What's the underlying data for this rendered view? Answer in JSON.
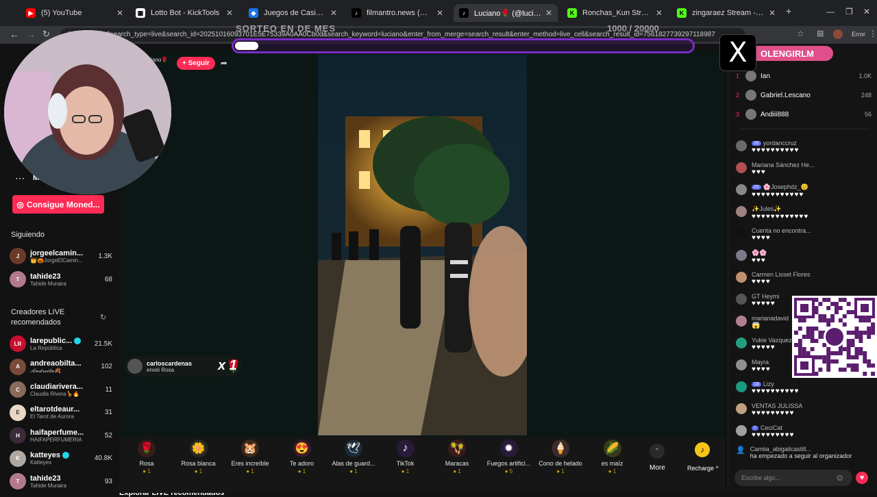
{
  "browser": {
    "tabs": [
      {
        "title": "(5) YouTube",
        "icon": "youtube-icon",
        "color": "#ff0000",
        "glyph": "▶",
        "active": false
      },
      {
        "title": "Lotto Bot - KickTools",
        "icon": "kicktools-icon",
        "color": "#ffffff",
        "glyph": "▦",
        "active": false
      },
      {
        "title": "Juegos de Casino Online | Apu",
        "icon": "casino-icon",
        "color": "#1a73e8",
        "glyph": "◆",
        "active": false
      },
      {
        "title": "filmantro.news (@filmantro.ne",
        "icon": "tiktok-icon",
        "color": "#000000",
        "glyph": "♪",
        "active": false
      },
      {
        "title": "Luciano🌹 (@lucianorj)",
        "icon": "tiktok-icon",
        "color": "#000000",
        "glyph": "♪",
        "active": true
      },
      {
        "title": "Ronchas_Kun Stream - Watch L",
        "icon": "kick-icon",
        "color": "#53fc18",
        "glyph": "K",
        "active": false
      },
      {
        "title": "zingaraez Stream - Watch Live",
        "icon": "kick-icon",
        "color": "#53fc18",
        "glyph": "K",
        "active": false
      }
    ],
    "new_tab": "+",
    "url": "lucianorj/live?search_type=live&search_id=20251016093701E5E75339A0AA0Cb0d&search_keyword=luciano&enter_from_merge=search_result&enter_method=live_cell&search_result_id=7561827739297118987",
    "error_label": "Error"
  },
  "overlay": {
    "progress_label": "SORTEO EN DE MES",
    "progress_count": "1000 / 20000",
    "progress_fraction": 0.05,
    "x_logo": "X",
    "handle": "OLENGIRLM"
  },
  "leftnav": {
    "more_label": "Más",
    "coins_button": "Consigue Moned...",
    "following_title": "Siguiendo",
    "following": [
      {
        "name": "jorgeelcamin...",
        "sub": "👑🎃JorgeElCamin...",
        "count": "1.3K",
        "color": "#6b3b2a",
        "initial": "J"
      },
      {
        "name": "tahide23",
        "sub": "Tahide Muraira",
        "count": "68",
        "color": "#b37a8c",
        "initial": "T"
      }
    ],
    "recommended_title_1": "Creadores LIVE",
    "recommended_title_2": "recomendados",
    "recommended": [
      {
        "name": "larepublic...",
        "sub": "La República",
        "count": "21.5K",
        "color": "#c8102e",
        "initial": "LR",
        "verified": true
      },
      {
        "name": "andreaobilta...",
        "sub": "𝓐𝓷𝓭𝓻𝓮𝓲𝓽𝓪🍂",
        "count": "102",
        "color": "#7a4a3a",
        "initial": "A",
        "verified": false
      },
      {
        "name": "claudiarivera...",
        "sub": "Claudia Rivera🦒🔥",
        "count": "11",
        "color": "#8a6a5a",
        "initial": "C",
        "verified": false
      },
      {
        "name": "eltarotdeaur...",
        "sub": "El Tarot de Aurora",
        "count": "31",
        "color": "#e8d7c5",
        "initial": "E",
        "verified": false
      },
      {
        "name": "haifaperfume...",
        "sub": "HAIFAPERFUMERIA",
        "count": "52",
        "color": "#3a2a3a",
        "initial": "H",
        "verified": false
      },
      {
        "name": "katteyes",
        "sub": "Katteyes",
        "count": "40.8K",
        "color": "#b0a8a0",
        "initial": "K",
        "verified": true
      },
      {
        "name": "tahide23",
        "sub": "Tahide Muraira",
        "count": "93",
        "color": "#b37a8c",
        "initial": "T",
        "verified": false
      }
    ],
    "bottom_text": "Explorar LIVE recomendados"
  },
  "player": {
    "host_name": "luciano🌹",
    "host_sub": "K",
    "follow_label": "+ Seguir",
    "gift_user": "carloscardenas",
    "gift_action": "envió Rosa",
    "gift_multiplier": "x 1"
  },
  "gifts": [
    {
      "name": "Rosa",
      "price": "1",
      "emoji": "🌹",
      "bg": "#3a1a1a"
    },
    {
      "name": "Rosa blanca",
      "price": "1",
      "emoji": "🌼",
      "bg": "#2a2a20"
    },
    {
      "name": "Eres increíble",
      "price": "1",
      "emoji": "🐹",
      "bg": "#3a2a1a"
    },
    {
      "name": "Te adoro",
      "price": "1",
      "emoji": "😍",
      "bg": "#3a1a2a"
    },
    {
      "name": "Alas de guard...",
      "price": "1",
      "emoji": "🕊",
      "bg": "#1a2a3a"
    },
    {
      "name": "TikTok",
      "price": "1",
      "emoji": "♪",
      "bg": "#2a1a3a"
    },
    {
      "name": "Maracas",
      "price": "1",
      "emoji": "🪇",
      "bg": "#3a1a1a"
    },
    {
      "name": "Fuegos artifici...",
      "price": "5",
      "emoji": "✹",
      "bg": "#2a1a3a"
    },
    {
      "name": "Cono de helado",
      "price": "1",
      "emoji": "🍦",
      "bg": "#3a2a2a"
    },
    {
      "name": "es maíz",
      "price": "1",
      "emoji": "🌽",
      "bg": "#3a3a1a"
    }
  ],
  "gift_more": "More",
  "recharge_label": "Recharge ^",
  "chat": {
    "ranking": [
      {
        "rank": "1",
        "name": "Ian",
        "score": "1.0K"
      },
      {
        "rank": "2",
        "name": "Gabriel.Lescano",
        "score": "248"
      },
      {
        "rank": "3",
        "name": "Andiii888",
        "score": "56"
      }
    ],
    "messages": [
      {
        "user": "yordanccruz",
        "badge": "20",
        "text": "♥♥♥♥♥♥♥♥♥♥",
        "color": "#6a6a6a"
      },
      {
        "user": "Mariana Sánchez He...",
        "badge": "",
        "text": "♥♥♥",
        "color": "#b05050"
      },
      {
        "user": "🌸Josephdz_😊",
        "badge": "25",
        "text": "♥♥♥♥♥♥♥♥♥♥♥",
        "color": "#888888"
      },
      {
        "user": "✨Jules✨",
        "badge": "",
        "text": "♥♥♥♥♥♥♥♥♥♥♥♥",
        "color": "#a08080"
      },
      {
        "user": "Cuenta no encontra...",
        "badge": "",
        "text": "♥♥♥♥",
        "color": "#111111"
      },
      {
        "user": "🌸🌸",
        "badge": "",
        "text": "♥♥♥",
        "color": "#7a7a8a"
      },
      {
        "user": "Carmen Lisset Flores",
        "badge": "",
        "text": "♥♥♥♥",
        "color": "#c09070"
      },
      {
        "user": "GT Heymi",
        "badge": "",
        "text": "♥♥♥♥♥",
        "color": "#555555"
      },
      {
        "user": "marianadavid",
        "badge": "",
        "text": "😱",
        "color": "#b08090"
      },
      {
        "user": "Yukie Vazquez",
        "badge": "",
        "text": "♥♥♥♥♥",
        "color": "#20a080"
      },
      {
        "user": "Mayra",
        "badge": "",
        "text": "♥♥♥♥",
        "color": "#909090"
      },
      {
        "user": "Lizy",
        "badge": "18",
        "text": "♥♥♥♥♥♥♥♥♥♥",
        "color": "#1a9a80"
      },
      {
        "user": "VENTAS JULISSA",
        "badge": "",
        "text": "♥♥♥♥♥♥♥♥♥",
        "color": "#c0a080"
      },
      {
        "user": "CeciCat",
        "badge": "7",
        "text": "♥♥♥♥♥♥♥♥♥",
        "color": "#a0a0a0"
      }
    ],
    "join_user": "Camiia_abigailcastill...",
    "join_text": "ha empezado a seguir al organizador",
    "input_placeholder": "Escribe algo..."
  }
}
